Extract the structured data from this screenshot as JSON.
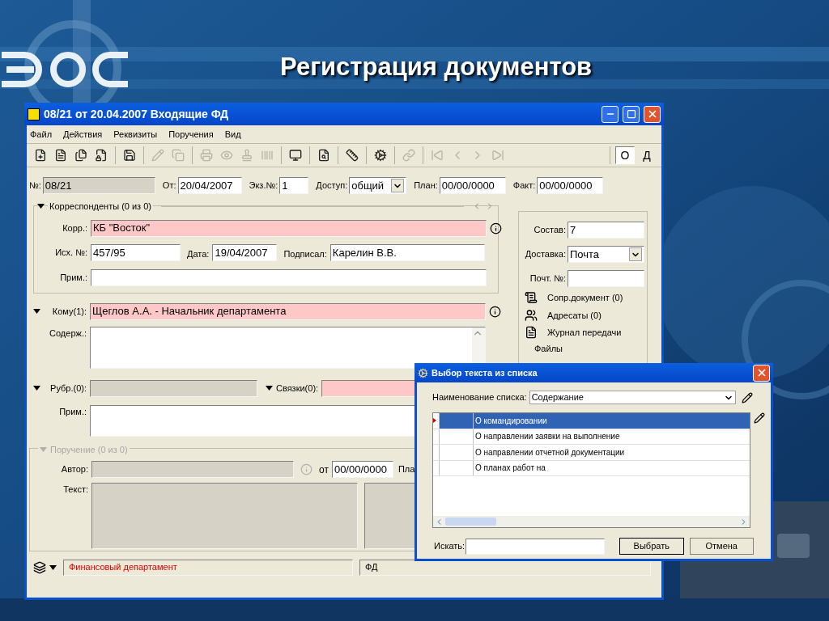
{
  "slide": {
    "title": "Регистрация документов"
  },
  "window": {
    "title": "08/21 от 20.04.2007 Входящие ФД",
    "menu": [
      "Файл",
      "Действия",
      "Реквизиты",
      "Поручения",
      "Вид"
    ],
    "toolbar": [
      {
        "kind": "button",
        "disabled": false
      },
      {
        "kind": "button",
        "disabled": false
      },
      {
        "kind": "button",
        "disabled": false
      },
      {
        "kind": "button",
        "disabled": false
      },
      {
        "kind": "separator"
      },
      {
        "kind": "button",
        "disabled": false
      },
      {
        "kind": "separator"
      },
      {
        "kind": "button",
        "disabled": true
      },
      {
        "kind": "button",
        "disabled": true
      },
      {
        "kind": "separator"
      },
      {
        "kind": "button",
        "disabled": true
      },
      {
        "kind": "button",
        "disabled": true
      },
      {
        "kind": "button",
        "disabled": true
      },
      {
        "kind": "button",
        "disabled": true
      },
      {
        "kind": "separator"
      },
      {
        "kind": "button",
        "disabled": false
      },
      {
        "kind": "separator"
      },
      {
        "kind": "button",
        "disabled": false
      },
      {
        "kind": "separator"
      },
      {
        "kind": "button",
        "disabled": false
      },
      {
        "kind": "separator"
      },
      {
        "kind": "button",
        "disabled": false
      },
      {
        "kind": "separator"
      },
      {
        "kind": "button",
        "disabled": true
      },
      {
        "kind": "separator"
      },
      {
        "kind": "button",
        "disabled": true
      },
      {
        "kind": "button",
        "disabled": true
      },
      {
        "kind": "button",
        "disabled": true
      },
      {
        "kind": "button",
        "disabled": true
      }
    ],
    "view_toggles": [
      {
        "label": "О",
        "selected": true
      },
      {
        "label": "Д",
        "selected": false
      }
    ]
  },
  "header_fields": [
    {
      "label": "№:",
      "value": "08/21",
      "kind": "readonly"
    },
    {
      "label": "От:",
      "value": "20/04/2007",
      "kind": "text"
    },
    {
      "label": "Экз.№:",
      "value": "1",
      "kind": "text"
    },
    {
      "label": "Доступ:",
      "value": "общий",
      "kind": "select"
    },
    {
      "label": "План:",
      "value": "00/00/0000",
      "kind": "text"
    },
    {
      "label": "Факт:",
      "value": "00/00/0000",
      "kind": "text"
    }
  ],
  "correspondents": {
    "title": "Корреспонденты (0 из 0)",
    "corr": {
      "label": "Корр.:",
      "value": "КБ \"Восток\"",
      "kind": "required"
    },
    "out_number": {
      "label": "Исх. №:",
      "value": "457/95",
      "kind": "text"
    },
    "date": {
      "label": "Дата:",
      "value": "19/04/2007",
      "kind": "text"
    },
    "signed": {
      "label": "Подписал:",
      "value": "Карелин В.В.",
      "kind": "text"
    },
    "note": {
      "label": "Прим.:",
      "kind": "text"
    }
  },
  "addressee": {
    "label": "Кому(1):",
    "value": "Щеглов А.А. - Начальник департамента",
    "kind": "required"
  },
  "content": {
    "label": "Содерж.:"
  },
  "rubrics": {
    "label": "Рубр.(0):",
    "kind": "readonly"
  },
  "links": {
    "label": "Связки(0):",
    "kind": "required"
  },
  "note": {
    "label": "Прим.:"
  },
  "side_panel": {
    "fields": [
      {
        "label": "Состав:",
        "value": "7",
        "kind": "text"
      },
      {
        "label": "Доставка:",
        "value": "Почта",
        "kind": "select"
      },
      {
        "label": "Почт. №:",
        "kind": "text"
      }
    ],
    "links": [
      "Сопр.документ (0)",
      "Адресаты (0)",
      "Журнал передачи"
    ],
    "files": "Файлы"
  },
  "assignment": {
    "title": "Поручение (0 из 0)",
    "disabled": true,
    "author_label": "Автор:",
    "date_label": "от",
    "date": "00/00/0000",
    "plan_label": "Пла",
    "text_label": "Текст:"
  },
  "status_bar": {
    "department": "Финансовый департамент",
    "code": "ФД"
  },
  "dialog": {
    "title": "Выбор текста из списка",
    "list_label": "Наименование списка:",
    "list_value": "Содержание",
    "rows": [
      {
        "text": "О командировании",
        "selected": true
      },
      {
        "text": "О направлении заявки на выполнение",
        "selected": false
      },
      {
        "text": "О направлении отчетной документации",
        "selected": false
      },
      {
        "text": "О планах работ на",
        "selected": false
      }
    ],
    "search_label": "Искать:",
    "buttons": [
      "Выбрать",
      "Отмена"
    ]
  }
}
